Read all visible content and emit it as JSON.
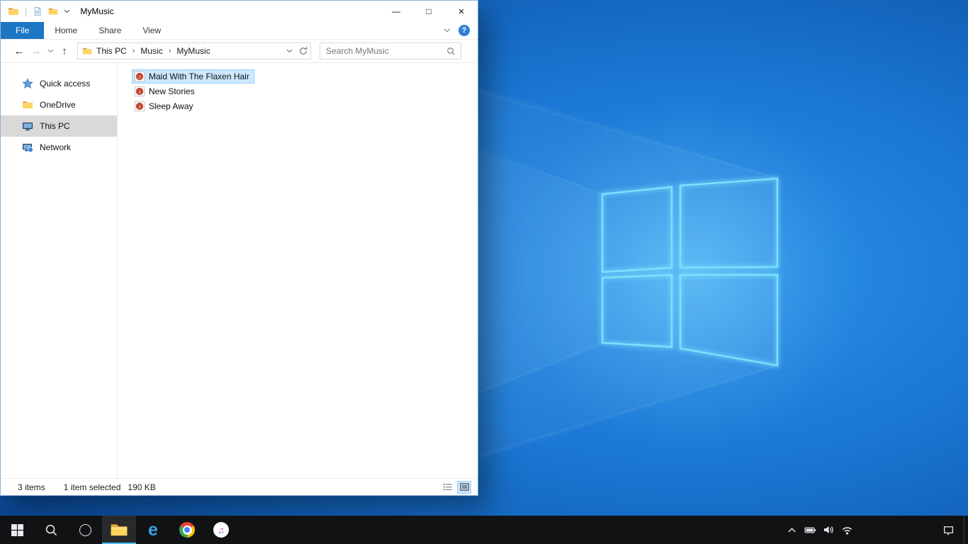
{
  "explorer": {
    "title": "MyMusic",
    "qat_separator": "|",
    "caption": {
      "minimize": "—",
      "maximize": "□",
      "close": "×"
    },
    "tabs": {
      "file": "File",
      "home": "Home",
      "share": "Share",
      "view": "View"
    },
    "help": "?",
    "nav": {
      "back": "←",
      "forward": "→",
      "up": "↑"
    },
    "breadcrumb": {
      "items": [
        "This PC",
        "Music",
        "MyMusic"
      ],
      "separator": "›"
    },
    "search": {
      "placeholder": "Search MyMusic"
    },
    "sidebar": {
      "items": [
        {
          "label": "Quick access",
          "icon": "star-icon",
          "selected": false
        },
        {
          "label": "OneDrive",
          "icon": "folder-icon",
          "selected": false
        },
        {
          "label": "This PC",
          "icon": "computer-icon",
          "selected": true
        },
        {
          "label": "Network",
          "icon": "network-icon",
          "selected": false
        }
      ]
    },
    "files": [
      {
        "name": "Maid With The Flaxen Hair",
        "icon": "music-file-icon",
        "selected": true
      },
      {
        "name": "New Stories",
        "icon": "music-file-icon",
        "selected": false
      },
      {
        "name": "Sleep Away",
        "icon": "music-file-icon",
        "selected": false
      }
    ],
    "status": {
      "count": "3 items",
      "selection": "1 item selected",
      "size": "190 KB"
    }
  },
  "taskbar": {
    "icons": [
      "start-icon",
      "search-icon",
      "cortana-icon",
      "file-explorer-icon",
      "internet-explorer-icon",
      "chrome-icon",
      "itunes-icon"
    ],
    "tray_icons": [
      "chevron-up-icon",
      "battery-icon",
      "volume-icon",
      "wifi-icon",
      "action-center-icon"
    ],
    "ie_glyph": "e",
    "itunes_note_glyph": "♫"
  },
  "colors": {
    "accent_blue": "#1d76c2",
    "selection_bg": "#cce8ff",
    "selection_border": "#99d1ff",
    "sidebar_selected": "#d9d9d9",
    "taskbar_bg": "#101214"
  }
}
